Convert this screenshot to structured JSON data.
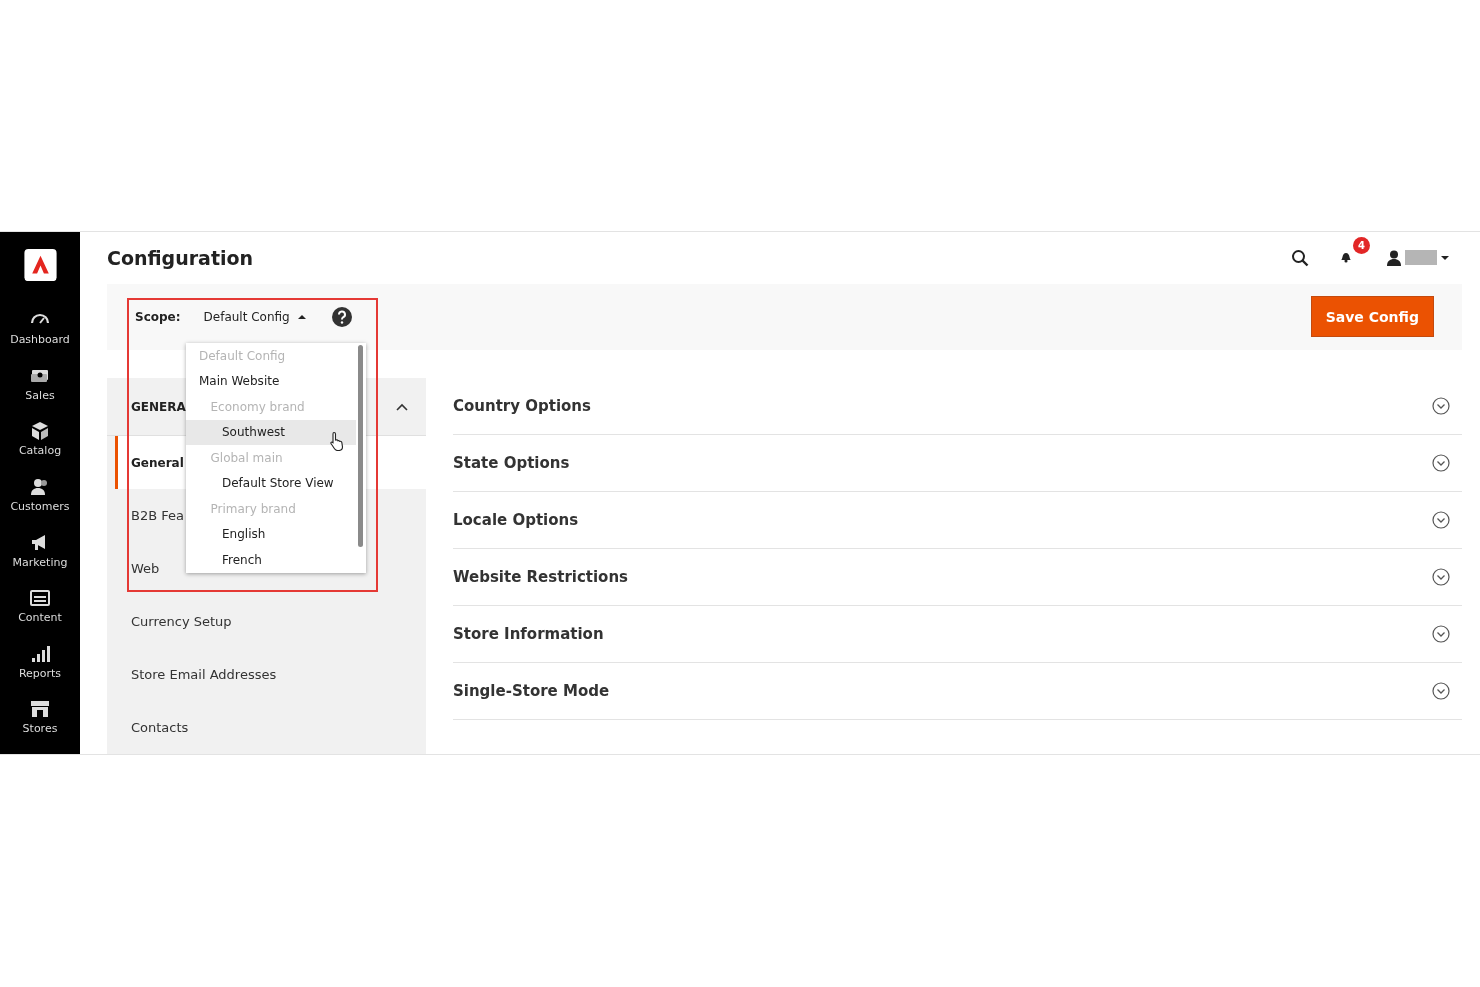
{
  "sidebar": {
    "items": [
      {
        "label": "Dashboard"
      },
      {
        "label": "Sales"
      },
      {
        "label": "Catalog"
      },
      {
        "label": "Customers"
      },
      {
        "label": "Marketing"
      },
      {
        "label": "Content"
      },
      {
        "label": "Reports"
      },
      {
        "label": "Stores"
      }
    ]
  },
  "header": {
    "title": "Configuration",
    "notifications": "4"
  },
  "scope": {
    "label": "Scope:",
    "value": "Default Config",
    "expanded": true,
    "options": [
      {
        "label": "Default Config",
        "disabled": true,
        "highlighted": false
      },
      {
        "label": "Main Website",
        "disabled": false,
        "highlighted": false,
        "children": [
          {
            "label": "Economy brand",
            "disabled": true,
            "highlighted": false,
            "children": [
              {
                "label": "Southwest",
                "disabled": false,
                "highlighted": true
              }
            ]
          },
          {
            "label": "Global main",
            "disabled": true,
            "highlighted": false,
            "children": [
              {
                "label": "Default Store View",
                "disabled": false,
                "highlighted": false
              }
            ]
          },
          {
            "label": "Primary brand",
            "disabled": true,
            "highlighted": false,
            "children": [
              {
                "label": "English",
                "disabled": false,
                "highlighted": false
              },
              {
                "label": "French",
                "disabled": false,
                "highlighted": false
              }
            ]
          }
        ]
      }
    ]
  },
  "save_button": "Save Config",
  "nav": {
    "group": "GENERA",
    "expanded": true,
    "items": [
      {
        "label": "General",
        "selected": true
      },
      {
        "label": "B2B Fea",
        "selected": false
      },
      {
        "label": "Web",
        "selected": false
      },
      {
        "label": "Currency Setup",
        "selected": false
      },
      {
        "label": "Store Email Addresses",
        "selected": false
      },
      {
        "label": "Contacts",
        "selected": false
      }
    ]
  },
  "sections": [
    {
      "title": "Country Options",
      "expanded": false
    },
    {
      "title": "State Options",
      "expanded": false
    },
    {
      "title": "Locale Options",
      "expanded": false
    },
    {
      "title": "Website Restrictions",
      "expanded": false
    },
    {
      "title": "Store Information",
      "expanded": false
    },
    {
      "title": "Single-Store Mode",
      "expanded": false
    }
  ]
}
